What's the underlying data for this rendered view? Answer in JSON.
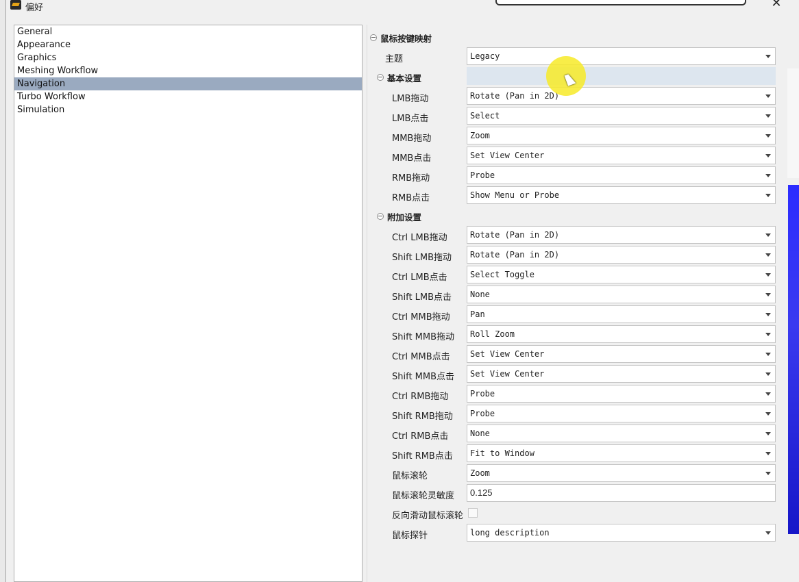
{
  "window": {
    "title": "偏好"
  },
  "nav": {
    "items": [
      {
        "label": "General"
      },
      {
        "label": "Appearance"
      },
      {
        "label": "Graphics"
      },
      {
        "label": "Meshing Workflow"
      },
      {
        "label": "Navigation"
      },
      {
        "label": "Turbo Workflow"
      },
      {
        "label": "Simulation"
      }
    ],
    "selected": "Navigation"
  },
  "panel": {
    "mouse_mapping": {
      "header": "鼠标按键映射",
      "theme_label": "主题",
      "theme_value": "Legacy"
    },
    "basic": {
      "header": "基本设置",
      "rows": [
        {
          "label": "LMB拖动",
          "value": "Rotate (Pan in 2D)"
        },
        {
          "label": "LMB点击",
          "value": "Select"
        },
        {
          "label": "MMB拖动",
          "value": "Zoom"
        },
        {
          "label": "MMB点击",
          "value": "Set View Center"
        },
        {
          "label": "RMB拖动",
          "value": "Probe"
        },
        {
          "label": "RMB点击",
          "value": "Show Menu or Probe"
        }
      ]
    },
    "extra": {
      "header": "附加设置",
      "rows": [
        {
          "label": "Ctrl LMB拖动",
          "value": "Rotate (Pan in 2D)"
        },
        {
          "label": "Shift LMB拖动",
          "value": "Rotate (Pan in 2D)"
        },
        {
          "label": "Ctrl LMB点击",
          "value": "Select Toggle"
        },
        {
          "label": "Shift LMB点击",
          "value": "None"
        },
        {
          "label": "Ctrl MMB拖动",
          "value": "Pan"
        },
        {
          "label": "Shift MMB拖动",
          "value": "Roll Zoom"
        },
        {
          "label": "Ctrl MMB点击",
          "value": "Set View Center"
        },
        {
          "label": "Shift MMB点击",
          "value": "Set View Center"
        },
        {
          "label": "Ctrl RMB拖动",
          "value": "Probe"
        },
        {
          "label": "Shift RMB拖动",
          "value": "Probe"
        },
        {
          "label": "Ctrl RMB点击",
          "value": "None"
        },
        {
          "label": "Shift RMB点击",
          "value": "Fit to Window"
        },
        {
          "label": "鼠标滚轮",
          "value": "Zoom"
        }
      ],
      "wheel_sensitivity_label": "鼠标滚轮灵敏度",
      "wheel_sensitivity_value": "0.125",
      "reverse_wheel_label": "反向滑动鼠标滚轮",
      "reverse_wheel_checked": false,
      "probe_label": "鼠标探针",
      "probe_value": "long description"
    }
  },
  "colors": {
    "selection": "#9aaac0",
    "dialog_bg": "#f0f0f0",
    "highlight": "#f7ea28"
  }
}
